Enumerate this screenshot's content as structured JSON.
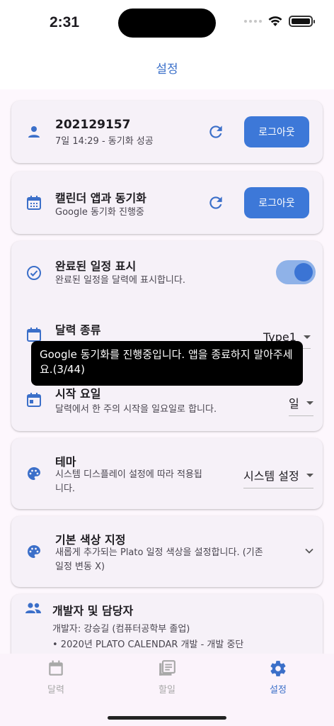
{
  "status": {
    "time": "2:31"
  },
  "app_bar": {
    "title": "설정"
  },
  "account": {
    "title": "202129157",
    "subtitle": "7일 14:29 - 동기화 성공",
    "button": "로그아웃"
  },
  "calendar_sync": {
    "title": "캘린더 앱과 동기화",
    "subtitle": "Google 동기화 진행중",
    "button": "로그아웃"
  },
  "display": {
    "completed": {
      "title": "완료된 일정 표시",
      "subtitle": "완료된 일정을 달력에 표시합니다.",
      "enabled": true
    },
    "calendar_type": {
      "title": "달력 종류",
      "value": "Type1"
    },
    "start_day": {
      "title": "시작 요일",
      "subtitle": "달력에서 한 주의 시작을 일요일로 합니다.",
      "value": "일"
    }
  },
  "toast": {
    "text": "Google 동기화를 진행중입니다. 앱을 종료하지 말아주세요.(3/44)"
  },
  "theme": {
    "title": "테마",
    "subtitle": "시스템 디스플레이 설정에 따라 적용됩니다.",
    "value": "시스템 설정"
  },
  "default_color": {
    "title": "기본 색상 지정",
    "subtitle": "새롭게 추가되는 Plato 일정 색상을 설정합니다. (기존 일정 변동 X)"
  },
  "developers": {
    "title": "개발자 및 담당자",
    "line1": "개발자: 강승길  (컴퓨터공학부 졸업)",
    "line2": "• 2020년 PLATO CALENDAR 개발 - 개발 중단"
  },
  "nav": {
    "items": [
      {
        "label": "달력",
        "icon": "calendar-icon",
        "active": false
      },
      {
        "label": "할일",
        "icon": "todo-list-icon",
        "active": false
      },
      {
        "label": "설정",
        "icon": "gear-icon",
        "active": true
      }
    ]
  },
  "colors": {
    "accent": "#3d78d8",
    "icon": "#3b6fc9",
    "background": "#fdf7fd"
  }
}
